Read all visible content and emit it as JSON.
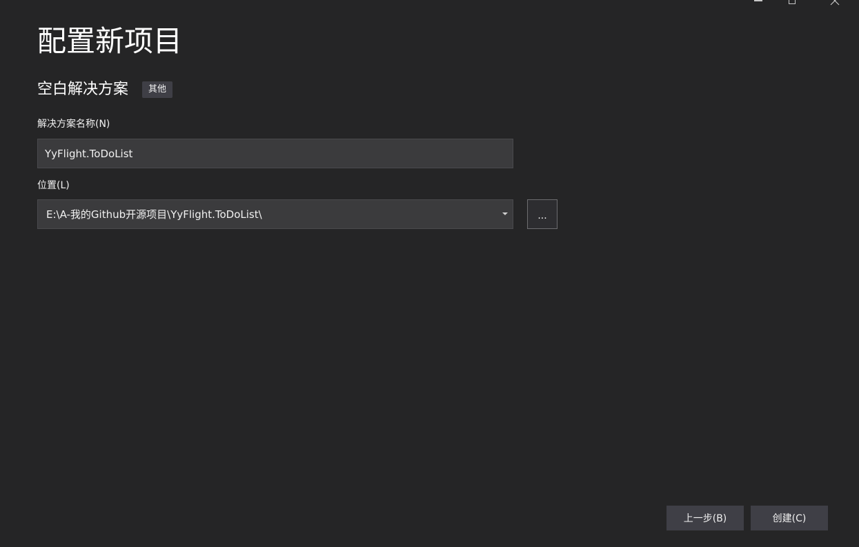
{
  "window_controls": {
    "minimize_icon": "minimize-icon",
    "maximize_icon": "maximize-icon",
    "close_icon": "close-icon"
  },
  "header": {
    "title": "配置新项目"
  },
  "template": {
    "name": "空白解决方案",
    "tag": "其他"
  },
  "form": {
    "solution_name_label": "解决方案名称(N)",
    "solution_name_value": "YyFlight.ToDoList",
    "location_label": "位置(L)",
    "location_value": "E:\\A-我的Github开源项目\\YyFlight.ToDoList\\",
    "browse_label": "..."
  },
  "footer": {
    "back_label": "上一步(B)",
    "create_label": "创建(C)"
  },
  "colors": {
    "background": "#252526",
    "input_background": "#3b3b3d",
    "button_background": "#3f3f46",
    "text": "#f1f1f1"
  }
}
